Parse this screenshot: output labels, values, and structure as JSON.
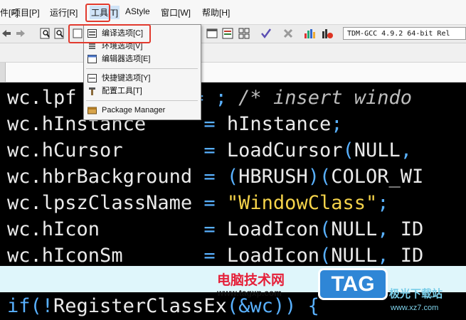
{
  "menubar": {
    "items": [
      "文件[F]",
      "项目[P]",
      "运行[R]",
      "工具[T]",
      "AStyle",
      "窗口[W]",
      "帮助[H]"
    ]
  },
  "toolbar": {
    "compiler_label": "TDM-GCC 4.9.2 64-bit Rel"
  },
  "tools_menu": {
    "items": [
      "编译选项[C]",
      "环境选项[V]",
      "编辑器选项[E]",
      "快捷键选项[Y]",
      "配置工具[T]",
      "Package Manager"
    ]
  },
  "code": {
    "l1_a": "wc.",
    "l1_b": "lpf",
    "l1_c": "=",
    "l1_d": "; ",
    "l1_e": "/* insert windo",
    "l2_a": "wc.",
    "l2_b": "hInstance",
    "l2_c": "=",
    "l2_d": "hInstance",
    "l2_e": ";",
    "l3_a": "wc.",
    "l3_b": "hCursor",
    "l3_c": "=",
    "l3_d": "LoadCursor",
    "l3_e": "(",
    "l3_f": "NULL",
    "l3_g": ",",
    "l4_a": "wc.",
    "l4_b": "hbrBackground",
    "l4_c": "=",
    "l4_d": "(",
    "l4_e": "HBRUSH",
    "l4_f": ")(",
    "l4_g": "COLOR_WI",
    "l5_a": "wc.",
    "l5_b": "lpszClassName",
    "l5_c": "=",
    "l5_d": "\"WindowClass\"",
    "l5_e": ";",
    "l6_a": "wc.",
    "l6_b": "hIcon",
    "l6_c": "=",
    "l6_d": "LoadIcon",
    "l6_e": "(",
    "l6_f": "NULL",
    "l6_g": ", ",
    "l6_h": "ID",
    "l7_a": "wc.",
    "l7_b": "hIconSm",
    "l7_c": "=",
    "l7_d": "LoadIcon",
    "l7_e": "(",
    "l7_f": "NULL",
    "l7_g": ", ",
    "l7_h": "ID",
    "l8_a": "if",
    "l8_b": "(!",
    "l8_c": "RegisterClassEx",
    "l8_d": "(&wc)) {"
  },
  "watermark": {
    "title": "电脑技术网",
    "url": "www.tagxp.com",
    "tag": "TAG",
    "right_text": "极光下载站",
    "right_url": "www.xz7.com"
  },
  "colors": {
    "highlight_red": "#e23a2e",
    "punct_blue": "#59b1ff",
    "string_yellow": "#f5d34a",
    "watermark_blue": "#2f86d6"
  }
}
